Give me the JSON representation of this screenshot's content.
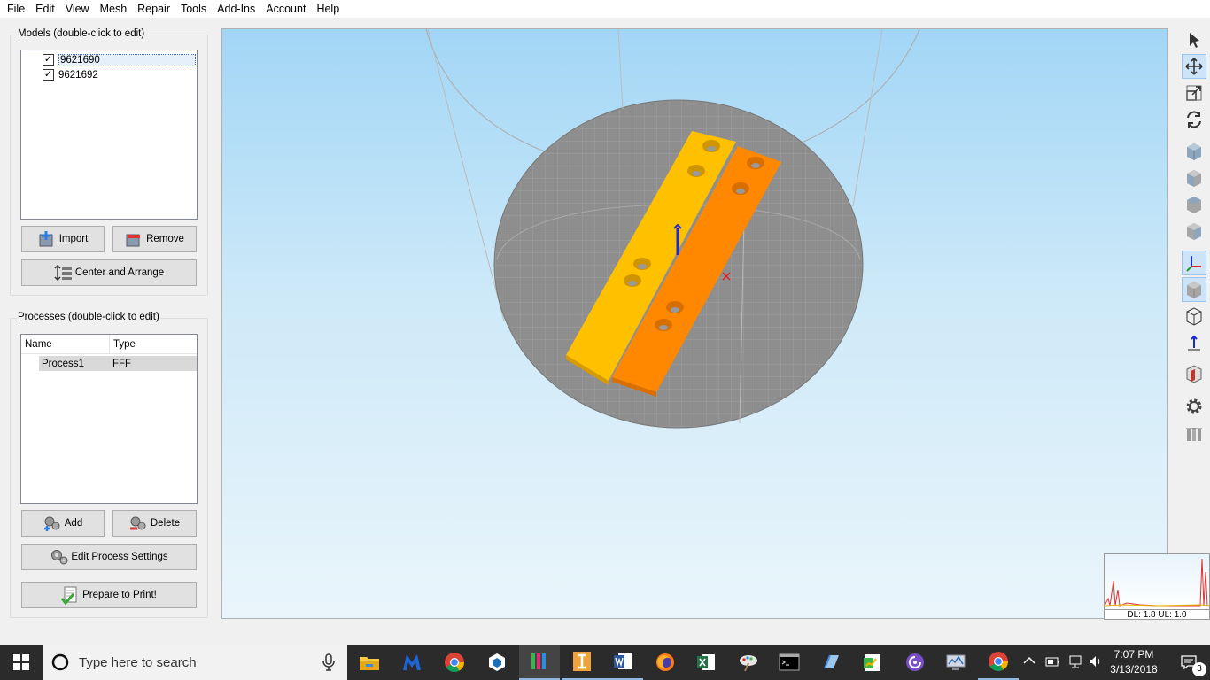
{
  "menu": [
    "File",
    "Edit",
    "View",
    "Mesh",
    "Repair",
    "Tools",
    "Add-Ins",
    "Account",
    "Help"
  ],
  "models": {
    "title": "Models (double-click to edit)",
    "items": [
      {
        "name": "9621690",
        "checked": true,
        "selected": true
      },
      {
        "name": "9621692",
        "checked": true,
        "selected": false
      }
    ],
    "import_label": "Import",
    "remove_label": "Remove",
    "center_label": "Center and Arrange"
  },
  "processes": {
    "title": "Processes (double-click to edit)",
    "columns": [
      "Name",
      "Type"
    ],
    "rows": [
      {
        "name": "Process1",
        "type": "FFF"
      }
    ],
    "add_label": "Add",
    "delete_label": "Delete",
    "edit_label": "Edit Process Settings",
    "prepare_label": "Prepare to Print!"
  },
  "graph_label": "DL: 1.8 UL: 1.0",
  "taskbar": {
    "search_placeholder": "Type here to search",
    "time": "7:07 PM",
    "date": "3/13/2018",
    "notifications": "3"
  },
  "colors": {
    "model_1": "#ffc000",
    "model_2": "#ff8800",
    "bed": "#8e8e8e",
    "accent": "#0078d7"
  },
  "icons": {
    "toolbar": [
      "select-arrow-icon",
      "move-icon",
      "scale-icon",
      "rotate-icon",
      "view-iso-icon",
      "view-front-icon",
      "view-top-icon",
      "view-side-icon",
      "axes-icon",
      "solid-view-icon",
      "wireframe-view-icon",
      "normal-arrow-icon",
      "cross-section-icon",
      "settings-gear-icon",
      "statistics-icon"
    ],
    "taskbar": [
      "windows-start-icon",
      "cortana-circle-icon",
      "microphone-icon",
      "file-explorer-icon",
      "malwarebytes-icon",
      "chrome-icon",
      "sketchup-icon",
      "simplify3d-icon",
      "inventor-icon",
      "word-icon",
      "firefox-icon",
      "excel-icon",
      "paint-icon",
      "command-prompt-icon",
      "notepad-icon",
      "project-icon",
      "torrent-icon",
      "network-monitor-icon",
      "chrome-icon-2",
      "chevron-up-icon",
      "battery-icon",
      "network-icon",
      "volume-icon",
      "notification-icon"
    ]
  }
}
